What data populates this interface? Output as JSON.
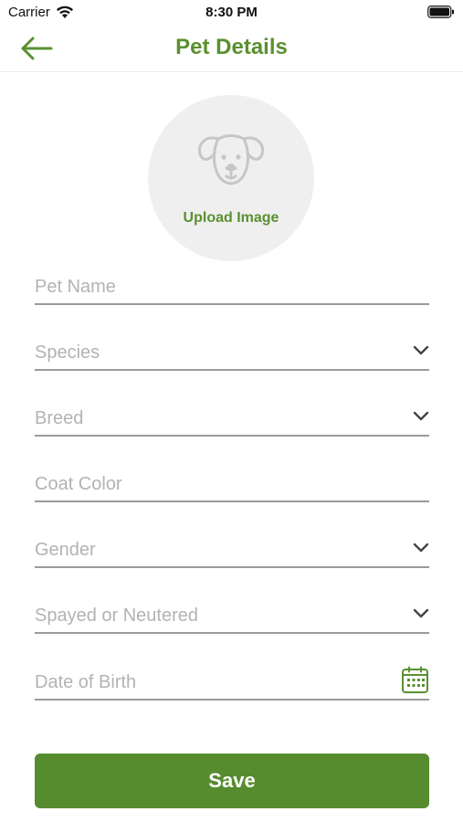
{
  "status_bar": {
    "carrier": "Carrier",
    "time": "8:30 PM"
  },
  "nav": {
    "title": "Pet Details",
    "back_icon": "arrow-left-icon"
  },
  "upload": {
    "label": "Upload Image",
    "icon": "dog-face-icon"
  },
  "fields": {
    "pet_name": {
      "placeholder": "Pet Name",
      "value": ""
    },
    "species": {
      "placeholder": "Species",
      "value": ""
    },
    "breed": {
      "placeholder": "Breed",
      "value": ""
    },
    "coat_color": {
      "placeholder": "Coat Color",
      "value": ""
    },
    "gender": {
      "placeholder": "Gender",
      "value": ""
    },
    "spayed_neutered": {
      "placeholder": "Spayed or Neutered",
      "value": ""
    },
    "date_of_birth": {
      "placeholder": "Date of Birth",
      "value": ""
    }
  },
  "save_button": {
    "label": "Save"
  },
  "colors": {
    "accent": "#5a902f",
    "button": "#568c2e",
    "placeholder": "#b3b3b3",
    "underline": "#9a9a9a",
    "circle": "#efefef"
  }
}
